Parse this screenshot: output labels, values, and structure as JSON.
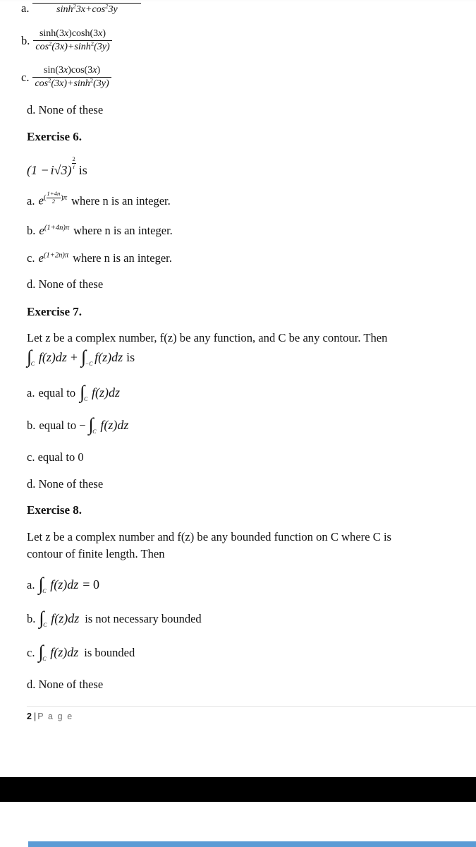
{
  "document": {
    "page_label_number": "2",
    "page_label_separator": "|",
    "page_label_word": "P a g e",
    "accent_color": "#5b9bd5",
    "rule_color": "#e2e2e2",
    "text_color": "#111111"
  },
  "exercise5_tail": {
    "options": [
      {
        "label": "a.",
        "type": "fraction",
        "numerator": "",
        "denominator_parts": [
          {
            "text": "sinh",
            "style": "italic"
          },
          {
            "text": "2",
            "style": "sup"
          },
          {
            "text": "3x+cos",
            "style": "italic"
          },
          {
            "text": "2",
            "style": "sup"
          },
          {
            "text": "3y",
            "style": "italic"
          }
        ],
        "denominator_plain": "sinh²3x+cos²3y"
      },
      {
        "label": "b.",
        "type": "fraction",
        "numerator_plain": "sinh(3x)cosh(3x)",
        "numerator_parts": [
          {
            "text": "sinh(3",
            "style": "roman"
          },
          {
            "text": "x",
            "style": "italic"
          },
          {
            "text": ")cosh(3",
            "style": "roman"
          },
          {
            "text": "x",
            "style": "italic"
          },
          {
            "text": ")",
            "style": "roman"
          }
        ],
        "denominator_plain": "cos²(3x)+sinh²(3y)",
        "denominator_parts": [
          {
            "text": "cos",
            "style": "italic"
          },
          {
            "text": "2",
            "style": "sup"
          },
          {
            "text": "(3x)+sinh",
            "style": "italic"
          },
          {
            "text": "2",
            "style": "sup"
          },
          {
            "text": "(3y)",
            "style": "italic"
          }
        ]
      },
      {
        "label": "c.",
        "type": "fraction",
        "numerator_plain": "sin(3x)cos(3x)",
        "numerator_parts": [
          {
            "text": "sin(3",
            "style": "roman"
          },
          {
            "text": "x",
            "style": "italic"
          },
          {
            "text": ")cos(3",
            "style": "roman"
          },
          {
            "text": "x",
            "style": "italic"
          },
          {
            "text": ")",
            "style": "roman"
          }
        ],
        "denominator_plain": "cos²(3x)+sinh²(3y)"
      },
      {
        "label": "d.",
        "type": "text",
        "text": "d. None of these"
      }
    ]
  },
  "exercise6": {
    "heading": "Exercise 6.",
    "stem_prefix": "(1 −",
    "stem_i": "i",
    "stem_sqrt": "√3",
    "stem_close": ")",
    "stem_exp_num": "2",
    "stem_exp_den": "i",
    "stem_suffix": "is",
    "stem_plain": "(1 − i√3)^(2/i) is",
    "options": [
      {
        "label": "a.",
        "base": "e",
        "exponent_kind": "fraction",
        "exp_frac_num": "1+4n",
        "exp_frac_den": "2",
        "exp_tail": "π",
        "tail_text": "where n is an integer.",
        "plain": "a. e^((1+4n)/2)π where n is an integer."
      },
      {
        "label": "b.",
        "base": "e",
        "exponent_kind": "inline",
        "exponent": "(1+4n)π",
        "tail_text": "where n is an integer.",
        "plain": "b. e^((1+4n)π) where n is an integer."
      },
      {
        "label": "c.",
        "base": "e",
        "exponent_kind": "inline",
        "exponent": "(1+2n)π",
        "tail_text": "where n is an integer.",
        "plain": "c. e^((1+2n)π) where n is an integer."
      },
      {
        "label": "d.",
        "type": "text",
        "text": "d. None of these"
      }
    ]
  },
  "exercise7": {
    "heading": "Exercise 7.",
    "stem_line1": "Let z be a complex number, f(z) be any function, and C be any contour. Then",
    "stem_math_plain": "∫_C f(z)dz + ∫_−C f(z)dz is",
    "stem_math": {
      "int1_sub": "C",
      "int1_body": "f(z)dz",
      "plus": "+",
      "int2_sub": "−C",
      "int2_body": "f(z)dz",
      "suffix": "is"
    },
    "options": [
      {
        "label": "a.",
        "lead": "equal to",
        "math_sub": "C",
        "math_body": "f(z)dz",
        "plain": "a. equal to ∫_C f(z)dz"
      },
      {
        "label": "b.",
        "lead": "equal to −",
        "math_sub": "C",
        "math_body": "f(z)dz",
        "plain": "b. equal to − ∫_C f(z)dz"
      },
      {
        "label": "c.",
        "type": "text",
        "text": "c. equal to 0"
      },
      {
        "label": "d.",
        "type": "text",
        "text": "d. None of these"
      }
    ]
  },
  "exercise8": {
    "heading": "Exercise 8.",
    "stem_line1": "Let z be a complex number and f(z) be any bounded function on C where C is",
    "stem_line2": "contour of finite length. Then",
    "options": [
      {
        "label": "a.",
        "math_sub": "C",
        "math_body": "f(z)dz",
        "tail": "= 0",
        "plain": "a. ∫_C f(z)dz = 0"
      },
      {
        "label": "b.",
        "math_sub": "C",
        "math_body": "f(z)dz",
        "tail": "is not necessary bounded",
        "plain": "b. ∫_C f(z)dz is not necessary bounded"
      },
      {
        "label": "c.",
        "math_sub": "C",
        "math_body": "f(z)dz",
        "tail": "is bounded",
        "plain": "c. ∫_C f(z)dz is bounded"
      },
      {
        "label": "d.",
        "type": "text",
        "text": "d. None of these"
      }
    ]
  }
}
